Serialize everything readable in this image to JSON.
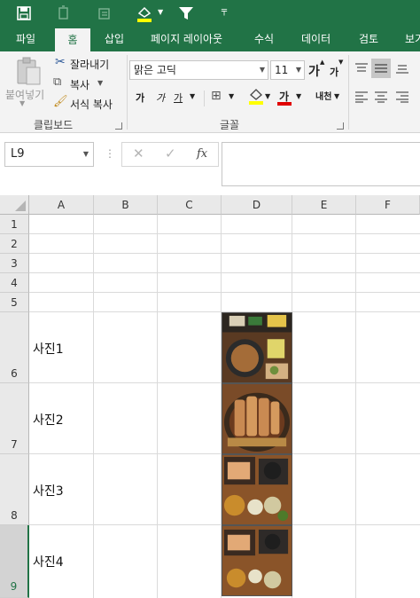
{
  "quick_access": {
    "icons": [
      "save-icon",
      "undo-icon",
      "redo-icon",
      "highlight-fill-icon",
      "filter-icon",
      "customize-qat-icon"
    ]
  },
  "tabs": [
    {
      "label": "파일",
      "active": false
    },
    {
      "label": "홈",
      "active": true
    },
    {
      "label": "삽입",
      "active": false
    },
    {
      "label": "페이지 레이아웃",
      "active": false
    },
    {
      "label": "수식",
      "active": false
    },
    {
      "label": "데이터",
      "active": false
    },
    {
      "label": "검토",
      "active": false
    },
    {
      "label": "보기",
      "active": false
    }
  ],
  "ribbon": {
    "clipboard": {
      "paste_label": "붙여넣기",
      "cut_label": "잘라내기",
      "copy_label": "복사",
      "format_painter_label": "서식 복사",
      "group_label": "클립보드"
    },
    "font": {
      "font_name": "맑은 고딕",
      "font_size": "11",
      "grow_label": "가",
      "shrink_label": "가",
      "bold_label": "가",
      "italic_label": "가",
      "underline_label": "가",
      "font_color_label": "가",
      "phonetic_label": "내천",
      "group_label": "글꼴"
    }
  },
  "formula_bar": {
    "name_box": "L9",
    "cancel": "✕",
    "enter": "✓",
    "fx": "fx",
    "value": ""
  },
  "grid": {
    "columns": [
      "A",
      "B",
      "C",
      "D",
      "E",
      "F"
    ],
    "rows": [
      "1",
      "2",
      "3",
      "4",
      "5",
      "6",
      "7",
      "8",
      "9"
    ],
    "selected_row": "9",
    "cells": [
      {
        "row": "6",
        "col": "A",
        "text": "사진1"
      },
      {
        "row": "7",
        "col": "A",
        "text": "사진2"
      },
      {
        "row": "8",
        "col": "A",
        "text": "사진3"
      },
      {
        "row": "9",
        "col": "A",
        "text": "사진4"
      }
    ]
  },
  "colors": {
    "accent": "#217346",
    "ribbon_bg": "#f3f3f3",
    "header_bg": "#e9e9e9"
  }
}
